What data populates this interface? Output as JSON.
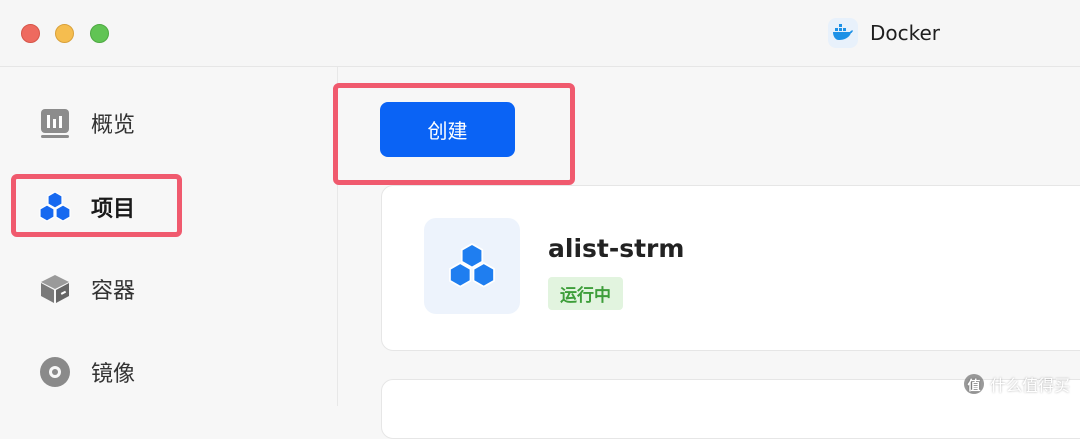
{
  "window": {
    "title": "Docker",
    "logo_icon": "docker-whale-icon"
  },
  "sidebar": {
    "items": [
      {
        "label": "概览",
        "icon": "overview-chart-icon",
        "active": false
      },
      {
        "label": "项目",
        "icon": "project-cubes-icon",
        "active": true
      },
      {
        "label": "容器",
        "icon": "container-box-icon",
        "active": false
      },
      {
        "label": "镜像",
        "icon": "image-disc-icon",
        "active": false
      }
    ]
  },
  "toolbar": {
    "create_label": "创建"
  },
  "projects": [
    {
      "name": "alist-strm",
      "status": "运行中",
      "icon": "project-cubes-icon"
    }
  ],
  "watermark": {
    "text": "什么值得买",
    "mark": "值"
  },
  "colors": {
    "accent": "#0a63f5",
    "highlight": "#f05a6e",
    "status_running_bg": "#e2f4df",
    "status_running_text": "#3e9e3a"
  }
}
